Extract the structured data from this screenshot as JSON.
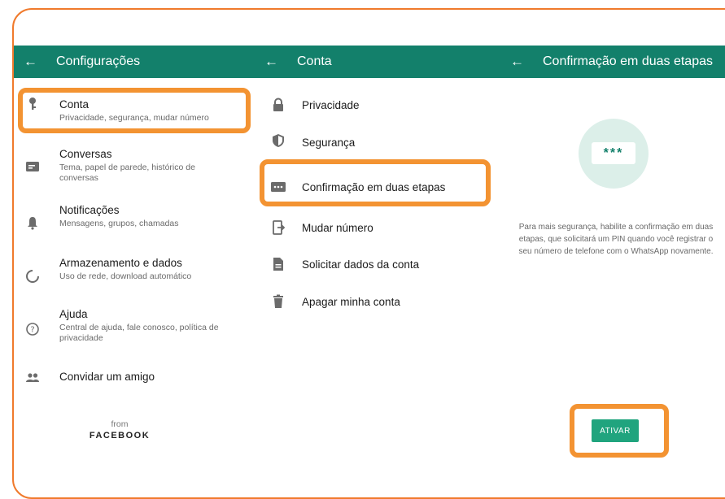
{
  "colors": {
    "appbar": "#13806b",
    "highlight": "#f39332",
    "frame": "#f07a2c",
    "button": "#20a47e"
  },
  "panel1": {
    "back_icon": "←",
    "title": "Configurações",
    "items": [
      {
        "icon": "key-icon",
        "label": "Conta",
        "sub": "Privacidade, segurança, mudar número"
      },
      {
        "icon": "chat-icon",
        "label": "Conversas",
        "sub": "Tema, papel de parede, histórico de conversas"
      },
      {
        "icon": "bell-icon",
        "label": "Notificações",
        "sub": "Mensagens, grupos, chamadas"
      },
      {
        "icon": "storage-icon",
        "label": "Armazenamento e dados",
        "sub": "Uso de rede, download automático"
      },
      {
        "icon": "help-icon",
        "label": "Ajuda",
        "sub": "Central de ajuda, fale conosco, política de privacidade"
      },
      {
        "icon": "people-icon",
        "label": "Convidar um amigo",
        "sub": ""
      }
    ],
    "footer_from": "from",
    "footer_brand": "FACEBOOK"
  },
  "panel2": {
    "back_icon": "←",
    "title": "Conta",
    "items": [
      {
        "icon": "lock-icon",
        "label": "Privacidade"
      },
      {
        "icon": "shield-icon",
        "label": "Segurança"
      },
      {
        "icon": "dots-icon",
        "label": "Confirmação em duas etapas"
      },
      {
        "icon": "phone-change-icon",
        "label": "Mudar número"
      },
      {
        "icon": "document-icon",
        "label": "Solicitar dados da conta"
      },
      {
        "icon": "trash-icon",
        "label": "Apagar minha conta"
      }
    ]
  },
  "panel3": {
    "back_icon": "←",
    "title": "Confirmação em duas etapas",
    "pin_text": "***",
    "description": "Para mais segurança, habilite a confirmação em duas etapas, que solicitará um PIN quando você registrar o seu número de telefone com o WhatsApp novamente.",
    "button_label": "ATIVAR"
  }
}
